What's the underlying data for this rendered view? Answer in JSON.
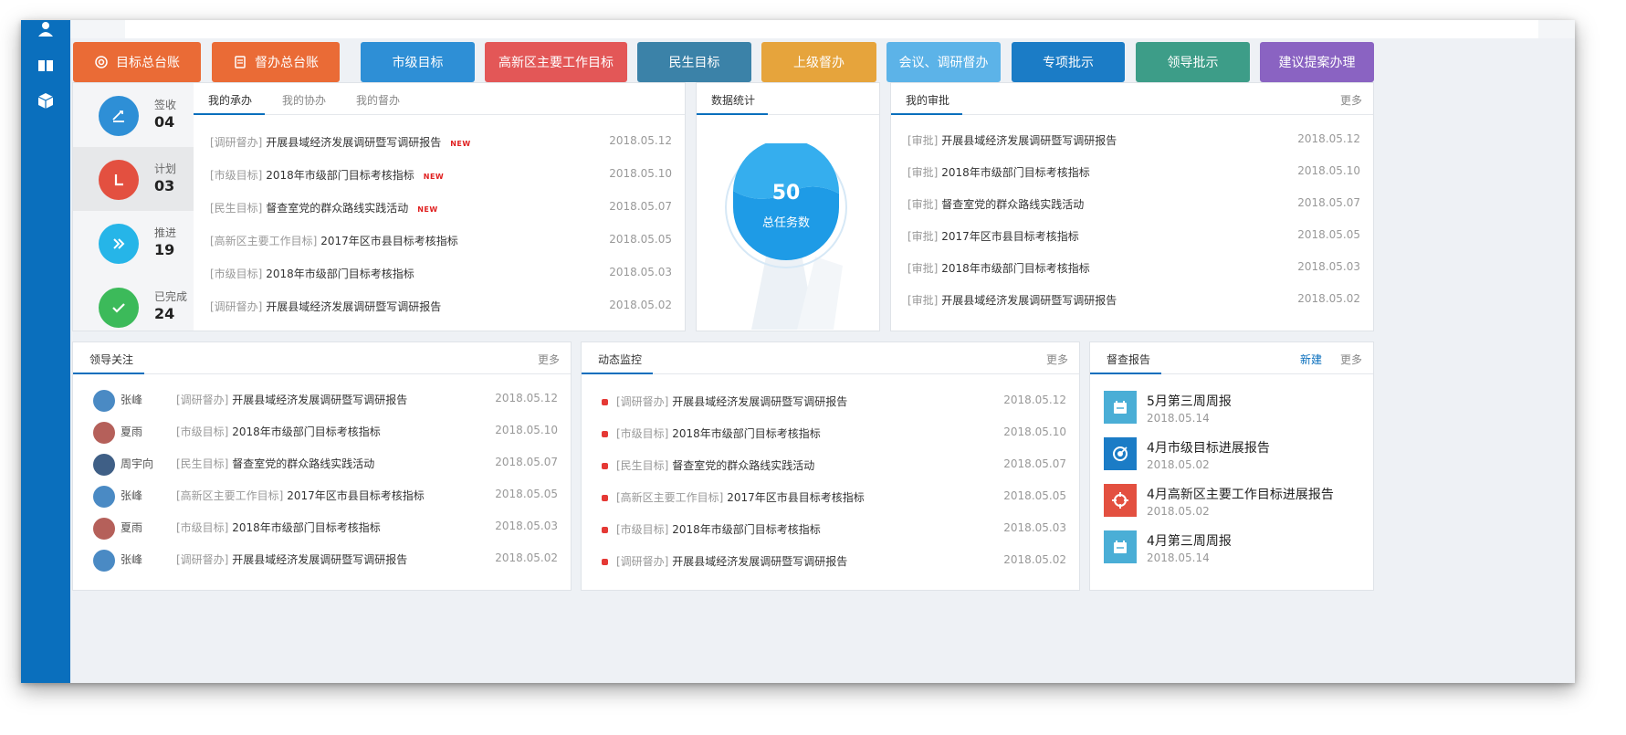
{
  "sidebar": {
    "icons": [
      "user-icon",
      "book-icon",
      "box-icon"
    ]
  },
  "colors": {
    "brand": "#0a6fbd",
    "accent_red": "#e53935"
  },
  "top_buttons": [
    {
      "label": "目标总台账",
      "icon": "target-icon",
      "color": "#ea6b36"
    },
    {
      "label": "督办总台账",
      "icon": "ledger-icon",
      "color": "#ea6b36"
    },
    {
      "label": "市级目标",
      "color": "#2e8fd6"
    },
    {
      "label": "高新区主要工作目标",
      "color": "#e35757"
    },
    {
      "label": "民生目标",
      "color": "#3b82a8"
    },
    {
      "label": "上级督办",
      "color": "#e6a43c"
    },
    {
      "label": "会议、调研督办",
      "color": "#5cb3e8"
    },
    {
      "label": "专项批示",
      "color": "#1b7cc6"
    },
    {
      "label": "领导批示",
      "color": "#3d9d88"
    },
    {
      "label": "建议提案办理",
      "color": "#8a63c2"
    }
  ],
  "stats": [
    {
      "label": "签收",
      "value": "04",
      "icon": "sign-icon",
      "color": "#2e8fd6"
    },
    {
      "label": "计划",
      "value": "03",
      "icon": "plan-icon",
      "color": "#e35040"
    },
    {
      "label": "推进",
      "value": "19",
      "icon": "forward-icon",
      "color": "#26b5e8"
    },
    {
      "label": "已完成",
      "value": "24",
      "icon": "check-icon",
      "color": "#3cba5a"
    }
  ],
  "undertake": {
    "tabs": [
      "我的承办",
      "我的协办",
      "我的督办"
    ],
    "rows": [
      {
        "cat": "[调研督办]",
        "text": "开展县域经济发展调研暨写调研报告",
        "date": "2018.05.12",
        "new": "NEW"
      },
      {
        "cat": "[市级目标]",
        "text": "2018年市级部门目标考核指标",
        "date": "2018.05.10",
        "new": "NEW"
      },
      {
        "cat": "[民生目标]",
        "text": "督查室党的群众路线实践活动",
        "date": "2018.05.07",
        "new": "NEW"
      },
      {
        "cat": "[高新区主要工作目标]",
        "text": "2017年区市县目标考核指标",
        "date": "2018.05.05",
        "new": ""
      },
      {
        "cat": "[市级目标]",
        "text": "2018年市级部门目标考核指标",
        "date": "2018.05.03",
        "new": ""
      },
      {
        "cat": "[调研督办]",
        "text": "开展县域经济发展调研暨写调研报告",
        "date": "2018.05.02",
        "new": ""
      }
    ]
  },
  "data_stats": {
    "title": "数据统计",
    "total": "50",
    "total_label": "总任务数"
  },
  "approval": {
    "title": "我的审批",
    "more": "更多",
    "rows": [
      {
        "cat": "[审批]",
        "text": "开展县域经济发展调研暨写调研报告",
        "date": "2018.05.12"
      },
      {
        "cat": "[审批]",
        "text": "2018年市级部门目标考核指标",
        "date": "2018.05.10"
      },
      {
        "cat": "[审批]",
        "text": "督查室党的群众路线实践活动",
        "date": "2018.05.07"
      },
      {
        "cat": "[审批]",
        "text": "2017年区市县目标考核指标",
        "date": "2018.05.05"
      },
      {
        "cat": "[审批]",
        "text": "2018年市级部门目标考核指标",
        "date": "2018.05.03"
      },
      {
        "cat": "[审批]",
        "text": "开展县域经济发展调研暨写调研报告",
        "date": "2018.05.02"
      }
    ]
  },
  "leaders": {
    "title": "领导关注",
    "more": "更多",
    "rows": [
      {
        "name": "张峰",
        "cat": "[调研督办]",
        "text": "开展县域经济发展调研暨写调研报告",
        "date": "2018.05.12",
        "avatar": "#4a8ac4"
      },
      {
        "name": "夏雨",
        "cat": "[市级目标]",
        "text": "2018年市级部门目标考核指标",
        "date": "2018.05.10",
        "avatar": "#b5605a"
      },
      {
        "name": "周宇向",
        "cat": "[民生目标]",
        "text": "督查室党的群众路线实践活动",
        "date": "2018.05.07",
        "avatar": "#3f5f86"
      },
      {
        "name": "张峰",
        "cat": "[高新区主要工作目标]",
        "text": "2017年区市县目标考核指标",
        "date": "2018.05.05",
        "avatar": "#4a8ac4"
      },
      {
        "name": "夏雨",
        "cat": "[市级目标]",
        "text": "2018年市级部门目标考核指标",
        "date": "2018.05.03",
        "avatar": "#b5605a"
      },
      {
        "name": "张峰",
        "cat": "[调研督办]",
        "text": "开展县域经济发展调研暨写调研报告",
        "date": "2018.05.02",
        "avatar": "#4a8ac4"
      }
    ]
  },
  "monitor": {
    "title": "动态监控",
    "more": "更多",
    "rows": [
      {
        "cat": "[调研督办]",
        "text": "开展县域经济发展调研暨写调研报告",
        "date": "2018.05.12"
      },
      {
        "cat": "[市级目标]",
        "text": "2018年市级部门目标考核指标",
        "date": "2018.05.10"
      },
      {
        "cat": "[民生目标]",
        "text": "督查室党的群众路线实践活动",
        "date": "2018.05.07"
      },
      {
        "cat": "[高新区主要工作目标]",
        "text": "2017年区市县目标考核指标",
        "date": "2018.05.05"
      },
      {
        "cat": "[市级目标]",
        "text": "2018年市级部门目标考核指标",
        "date": "2018.05.03"
      },
      {
        "cat": "[调研督办]",
        "text": "开展县域经济发展调研暨写调研报告",
        "date": "2018.05.02"
      }
    ]
  },
  "reports": {
    "title": "督查报告",
    "new_label": "新建",
    "more": "更多",
    "items": [
      {
        "title": "5月第三周周报",
        "date": "2018.05.14",
        "icon": "calendar-icon",
        "color": "#4aaed6"
      },
      {
        "title": "4月市级目标进展报告",
        "date": "2018.05.02",
        "icon": "target-icon",
        "color": "#1b7cc6"
      },
      {
        "title": "4月高新区主要工作目标进展报告",
        "date": "2018.05.02",
        "icon": "crosshair-icon",
        "color": "#e35040"
      },
      {
        "title": "4月第三周周报",
        "date": "2018.05.14",
        "icon": "calendar-icon",
        "color": "#4aaed6"
      }
    ]
  }
}
